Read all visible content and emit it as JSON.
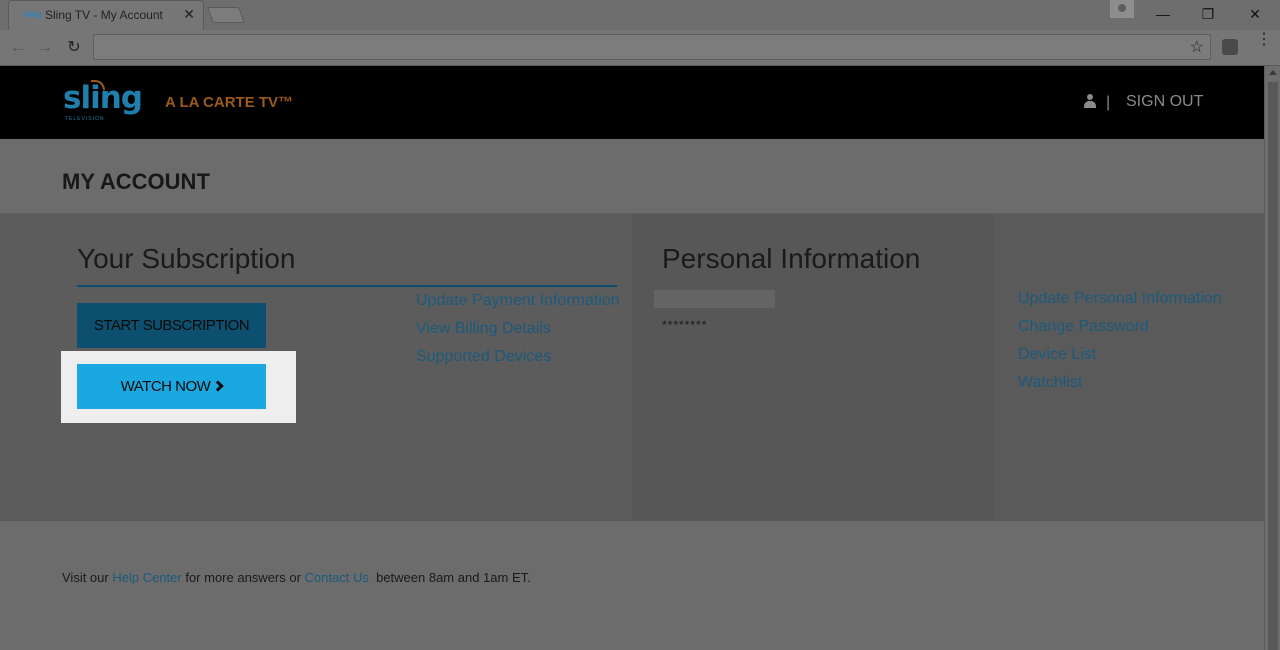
{
  "browser": {
    "tab_title": "Sling TV - My Account",
    "tab_favicon_text": "sling",
    "tab_close": "✕",
    "win_minimize": "—",
    "win_restore": "❐",
    "win_close": "✕",
    "back_icon": "←",
    "forward_icon": "→",
    "reload_icon": "↻",
    "star_icon": "☆",
    "menu_icon": "⋮"
  },
  "header": {
    "logo_text": "sling",
    "logo_sub": "TELEVISION",
    "tagline": "A LA CARTE TV™",
    "separator": "|",
    "signout_label": "SIGN OUT"
  },
  "account": {
    "title": "MY ACCOUNT"
  },
  "subscription": {
    "title": "Your Subscription",
    "start_label": "START SUBSCRIPTION",
    "watch_label": "WATCH NOW",
    "links": [
      "Update Payment Information",
      "View Billing Details",
      "Supported Devices"
    ]
  },
  "personal": {
    "title": "Personal Information",
    "password_mask": "********",
    "links": [
      "Update Personal Information",
      "Change Password",
      "Device List",
      "Watchlist"
    ]
  },
  "footer": {
    "prefix": "Visit our ",
    "help_center": "Help Center",
    "middle": " for more answers or ",
    "contact_us": "Contact Us",
    "suffix": "  between 8am and 1am ET."
  }
}
